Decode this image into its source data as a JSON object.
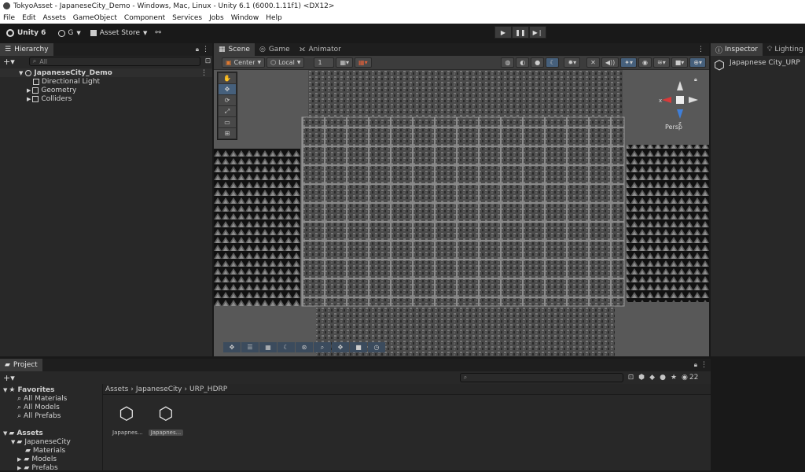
{
  "window": {
    "title": "TokyoAsset - JapaneseCity_Demo - Windows, Mac, Linux - Unity 6.1 (6000.1.11f1) <DX12>"
  },
  "menu": [
    "File",
    "Edit",
    "Assets",
    "GameObject",
    "Component",
    "Services",
    "Jobs",
    "Window",
    "Help"
  ],
  "toolbar": {
    "unity_label": "Unity 6",
    "account_label": "G",
    "asset_store_label": "Asset Store"
  },
  "hierarchy": {
    "tab_label": "Hierarchy",
    "search_placeholder": "All",
    "scene_name": "JapaneseCity_Demo",
    "items": [
      "Directional Light",
      "Geometry",
      "Colliders"
    ]
  },
  "scene_tabs": [
    "Scene",
    "Game",
    "Animator"
  ],
  "scene_toolbar": {
    "pivot_label": "Center",
    "space_label": "Local",
    "snap_value": "1"
  },
  "gizmo": {
    "projection_label": "Persp",
    "x_label": "x",
    "z_label": "z"
  },
  "inspector": {
    "tabs": [
      "Inspector",
      "Lighting"
    ],
    "object_name": "Japapnese City_URP"
  },
  "project": {
    "tab_label": "Project",
    "breadcrumb": [
      "Assets",
      "JapaneseCity",
      "URP_HDRP"
    ],
    "hidden_count": "22",
    "favorites_label": "Favorites",
    "favorites": [
      "All Materials",
      "All Models",
      "All Prefabs"
    ],
    "assets_label": "Assets",
    "assets_tree": {
      "root": "JapaneseCity",
      "children": [
        "Materials",
        "Models",
        "Prefabs"
      ]
    },
    "files": [
      "Japapnes...",
      "Japapnes..."
    ]
  },
  "colors": {
    "accent": "#46607c",
    "panel": "#282828",
    "background": "#191919"
  }
}
